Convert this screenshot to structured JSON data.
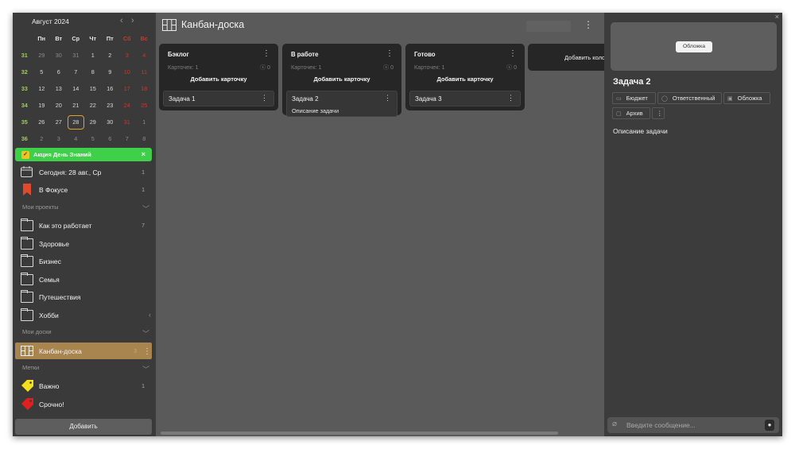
{
  "calendar": {
    "month_label": "Август 2024",
    "prev_icon": "‹",
    "next_icon": "›",
    "weekdays": [
      "Пн",
      "Вт",
      "Ср",
      "Чт",
      "Пт",
      "Сб",
      "Вс"
    ],
    "weeks": [
      {
        "num": "31",
        "days": [
          "29",
          "30",
          "31",
          "1",
          "2",
          "3",
          "4"
        ]
      },
      {
        "num": "32",
        "days": [
          "5",
          "6",
          "7",
          "8",
          "9",
          "10",
          "11"
        ]
      },
      {
        "num": "33",
        "days": [
          "12",
          "13",
          "14",
          "15",
          "16",
          "17",
          "18"
        ]
      },
      {
        "num": "34",
        "days": [
          "19",
          "20",
          "21",
          "22",
          "23",
          "24",
          "25"
        ]
      },
      {
        "num": "35",
        "days": [
          "26",
          "27",
          "28",
          "29",
          "30",
          "31",
          "1"
        ]
      },
      {
        "num": "36",
        "days": [
          "2",
          "3",
          "4",
          "5",
          "6",
          "7",
          "8"
        ]
      }
    ]
  },
  "promo": {
    "label": "Акция День Знаний",
    "close": "×"
  },
  "smart_lists": [
    {
      "label": "Сегодня: 28 авг., Ср",
      "count": "1",
      "icon": "calendar-icon"
    },
    {
      "label": "В Фокусе",
      "count": "1",
      "icon": "bookmark-icon"
    }
  ],
  "projects_header": "Мои проекты",
  "projects": [
    {
      "label": "Как это работает",
      "count": "7"
    },
    {
      "label": "Здоровье",
      "count": ""
    },
    {
      "label": "Бизнес",
      "count": ""
    },
    {
      "label": "Семья",
      "count": ""
    },
    {
      "label": "Путешествия",
      "count": ""
    },
    {
      "label": "Хобби",
      "count": ""
    }
  ],
  "boards_header": "Мои доски",
  "boards": [
    {
      "label": "Канбан-доска",
      "count": "3"
    }
  ],
  "tags_header": "Метки",
  "tags": [
    {
      "label": "Важно",
      "count": "1",
      "color": "#f5e020"
    },
    {
      "label": "Срочно!",
      "count": "",
      "color": "#e02020"
    }
  ],
  "add_button": "Добавить",
  "board": {
    "title": "Канбан-доска",
    "more_icon": "⋮",
    "add_column": "Добавить колонку",
    "columns": [
      {
        "title": "Бэклог",
        "count_label": "Карточек: 1",
        "budget": "ⓢ 0",
        "add_card": "Добавить карточку",
        "card": {
          "title": "Задача 1",
          "desc": ""
        }
      },
      {
        "title": "В работе",
        "count_label": "Карточек: 1",
        "budget": "ⓢ 0",
        "add_card": "Добавить карточку",
        "card": {
          "title": "Задача 2",
          "desc": "Описание задачи"
        }
      },
      {
        "title": "Готово",
        "count_label": "Карточек: 1",
        "budget": "ⓢ 0",
        "add_card": "Добавить карточку",
        "card": {
          "title": "Задача 3",
          "desc": ""
        }
      }
    ]
  },
  "panel": {
    "close": "×",
    "cover_button": "Обложка",
    "title": "Задача 2",
    "chips": {
      "budget": "Бюджет",
      "assignee": "Ответственный",
      "cover": "Обложка",
      "archive": "Архив",
      "more": "⋮"
    },
    "description": "Описание задачи",
    "message_placeholder": "Введите сообщение..."
  },
  "colors": {
    "sidebar_bg": "#3a3a3a",
    "main_bg": "#5a5a5a",
    "column_bg": "#262626",
    "promo_green": "#3fd04a",
    "active_board": "#a8844e",
    "weekend_red": "#c8372d",
    "week_number_green": "#9bd24a",
    "today_border": "#e0a030"
  }
}
